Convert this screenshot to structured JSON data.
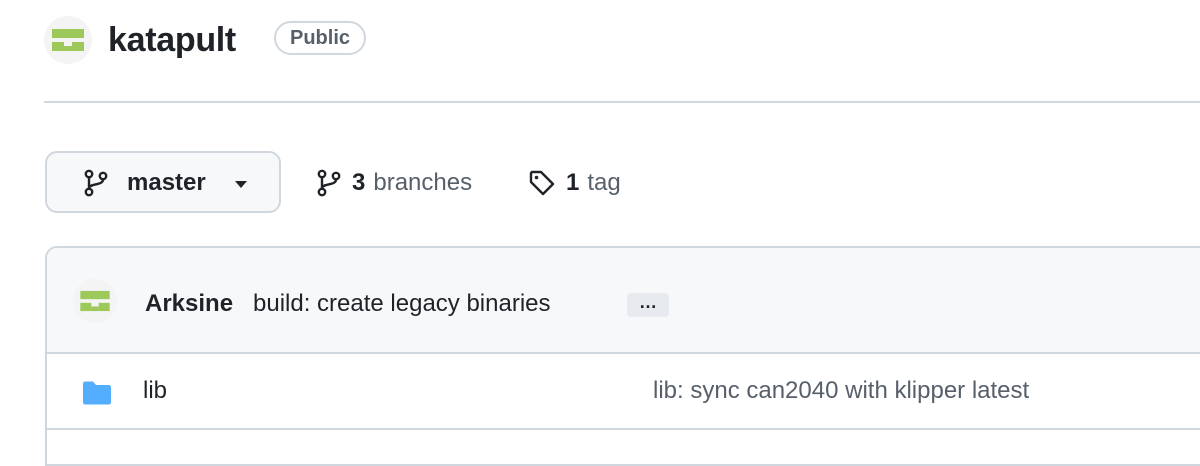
{
  "repo": {
    "name": "katapult",
    "visibility": "Public"
  },
  "branch_selector": {
    "current": "master",
    "icon": "git-branch-icon"
  },
  "stats": {
    "branches_count": "3",
    "branches_label": "branches",
    "tags_count": "1",
    "tags_label": "tag"
  },
  "latest_commit": {
    "author": "Arksine",
    "message": "build: create legacy binaries",
    "expand_label": "…"
  },
  "files": [
    {
      "name": "lib",
      "type": "folder",
      "last_commit": "lib: sync can2040 with klipper latest"
    }
  ],
  "colors": {
    "avatar_green": "#9cc95a",
    "folder_blue": "#54aeff",
    "border": "#d0d7de",
    "muted_text": "#57606a"
  }
}
